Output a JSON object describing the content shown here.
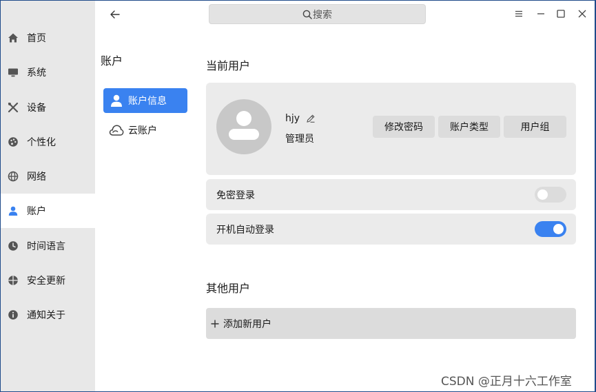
{
  "nav": {
    "items": [
      {
        "label": "首页",
        "icon": "home-icon"
      },
      {
        "label": "系统",
        "icon": "monitor-icon"
      },
      {
        "label": "设备",
        "icon": "tools-icon"
      },
      {
        "label": "个性化",
        "icon": "palette-icon"
      },
      {
        "label": "网络",
        "icon": "globe-icon"
      },
      {
        "label": "账户",
        "icon": "user-icon",
        "active": true
      },
      {
        "label": "时间语言",
        "icon": "clock-icon"
      },
      {
        "label": "安全更新",
        "icon": "shield-icon"
      },
      {
        "label": "通知关于",
        "icon": "info-icon"
      }
    ]
  },
  "sub": {
    "title": "账户",
    "items": [
      {
        "label": "账户信息",
        "icon": "user-icon",
        "active": true
      },
      {
        "label": "云账户",
        "icon": "cloud-icon"
      }
    ]
  },
  "search": {
    "label": "搜索"
  },
  "main": {
    "current_title": "当前用户",
    "user": {
      "name": "hjy",
      "role": "管理员"
    },
    "buttons": {
      "change_password": "修改密码",
      "account_type": "账户类型",
      "user_group": "用户组"
    },
    "rows": [
      {
        "label": "免密登录",
        "enabled": false
      },
      {
        "label": "开机自动登录",
        "enabled": true
      }
    ],
    "others_title": "其他用户",
    "add_user": "添加新用户"
  },
  "watermark": "CSDN @正月十六工作室",
  "colors": {
    "accent": "#3a82f0",
    "nav_bg": "#e8e8e8",
    "card_bg": "#ebebeb"
  }
}
